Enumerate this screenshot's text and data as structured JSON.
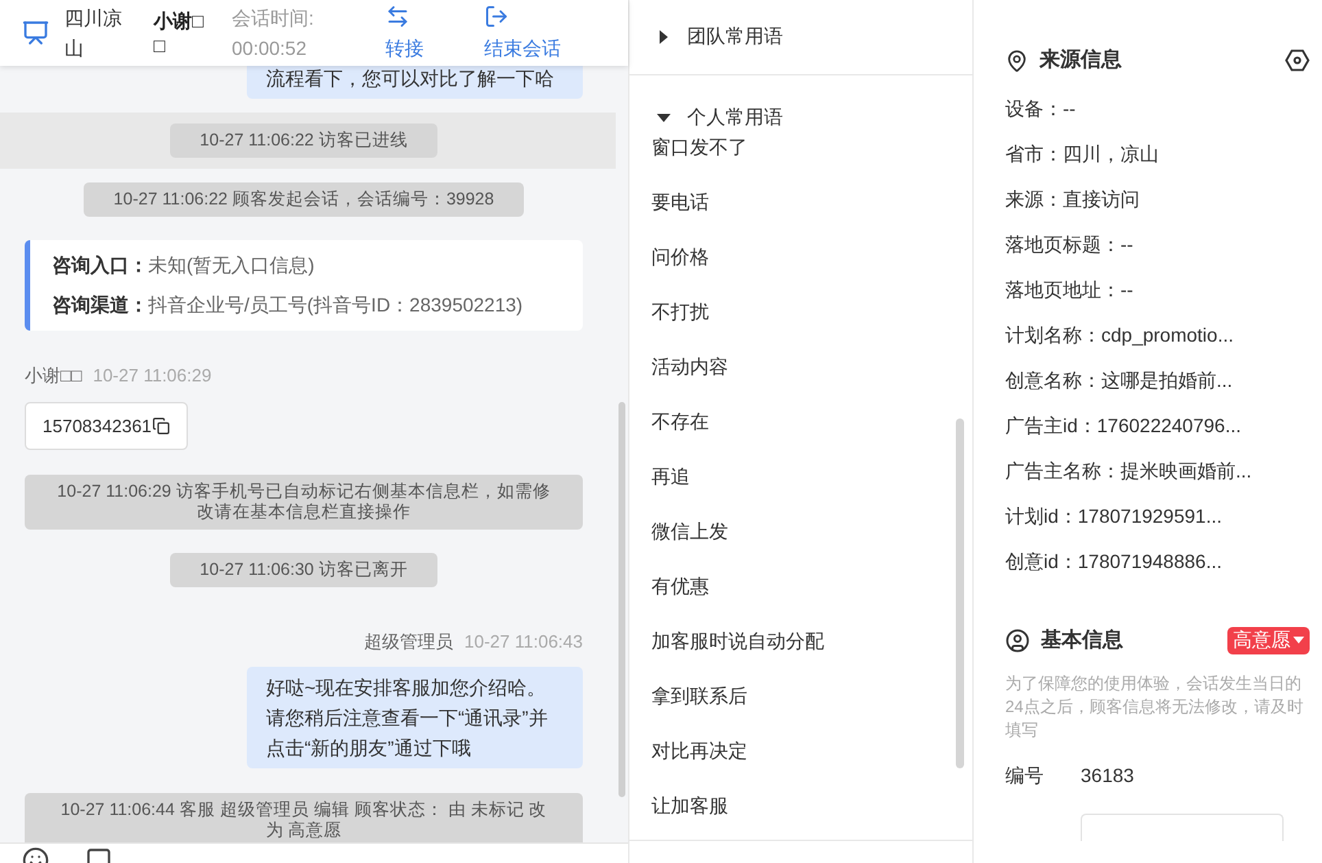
{
  "header": {
    "location": "四川凉山",
    "agent": "小谢□□",
    "timer_label": "会话时间:",
    "timer": "00:00:52",
    "actions": [
      {
        "kind": "transfer",
        "label": "转接"
      },
      {
        "kind": "end",
        "label": "结束会话"
      }
    ]
  },
  "messages": [
    {
      "kind": "agent",
      "text": "流程看下，您可以对比了解一下哈"
    },
    {
      "kind": "system",
      "text": "10-27 11:06:22 访客已进线",
      "highlighted": true
    },
    {
      "kind": "system",
      "text": "10-27 11:06:22 顾客发起会话，会话编号：39928",
      "highlighted": false
    },
    {
      "kind": "source",
      "rows": [
        {
          "label": "咨询入口：",
          "value": "未知(暂无入口信息)"
        },
        {
          "label": "咨询渠道：",
          "value": "抖音企业号/员工号(抖音号ID：2839502213)"
        }
      ]
    },
    {
      "kind": "visitor",
      "sender": "小谢□□",
      "time": "10-27 11:06:29",
      "text": "15708342361"
    },
    {
      "kind": "system",
      "text": "10-27 11:06:29 访客手机号已自动标记右侧基本信息栏，如需修改请在基本信息栏直接操作",
      "highlighted": false
    },
    {
      "kind": "system",
      "text": "10-27 11:06:30 访客已离开",
      "highlighted": false
    },
    {
      "kind": "agent",
      "sender": "超级管理员",
      "time": "10-27 11:06:43",
      "text": "好哒~现在安排客服加您介绍哈。请您稍后注意查看一下“通讯录”并点击“新的朋友”通过下哦"
    },
    {
      "kind": "system",
      "text": "10-27 11:06:44 客服 超级管理员 编辑 顾客状态： 由 未标记 改为 高意愿",
      "highlighted": false
    }
  ],
  "phrases": [
    {
      "title": "团队常用语",
      "expanded": false
    },
    {
      "title": "个人常用语",
      "expanded": true,
      "items": [
        "窗口发不了",
        "要电话",
        "问价格",
        "不打扰",
        "活动内容",
        "不存在",
        "再追",
        "微信上发",
        "有优惠",
        "加客服时说自动分配",
        "拿到联系后",
        "对比再决定",
        "让加客服"
      ]
    }
  ],
  "source_info": {
    "title": "来源信息",
    "rows": [
      "设备：--",
      "省市：四川，凉山",
      "来源：直接访问",
      "落地页标题：--",
      "落地页地址：--",
      "计划名称：cdp_promotio...",
      "创意名称：这哪是拍婚前...",
      "广告主id：176022240796...",
      "广告主名称：提米映画婚前...",
      "计划id：178071929591...",
      "创意id：178071948886..."
    ]
  },
  "basic_info": {
    "title": "基本信息",
    "tag": "高意愿",
    "note": "为了保障您的使用体验，会话发生当日的24点之后，顾客信息将无法修改，请及时填写",
    "fields": [
      {
        "label": "编号",
        "value": "36183"
      }
    ]
  }
}
